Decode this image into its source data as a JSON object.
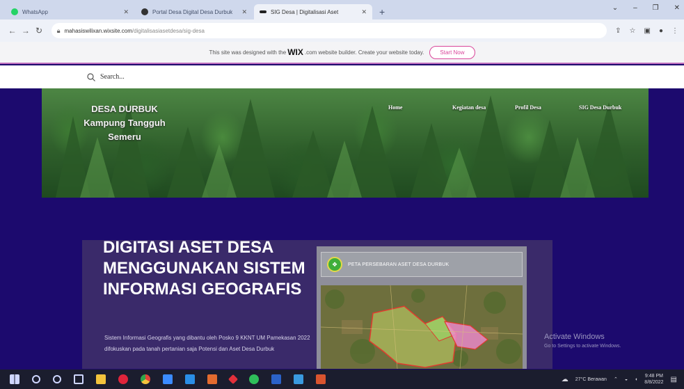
{
  "browser": {
    "tabs": [
      {
        "label": "WhatsApp",
        "color": "#25d366",
        "active": false
      },
      {
        "label": "Portal Desa Digital Desa Durbuk",
        "color": "#333333",
        "active": false
      },
      {
        "label": "SIG Desa | Digitalisasi Aset",
        "color": "#222222",
        "active": true
      }
    ],
    "new_tab": "+",
    "url_host": "mahasiswilixan.wixsite.com",
    "url_path": "/digitalisasiasetdesa/sig-desa"
  },
  "wix_banner": {
    "text_before": "This site was designed with the",
    "logo": "WIX",
    "text_after": ".com website builder. Create your website today.",
    "start_button": "Start Now"
  },
  "search": {
    "label": "Search..."
  },
  "site": {
    "brand_line1": "DESA DURBUK",
    "brand_line2": "Kampung Tangguh",
    "brand_line3": "Semeru",
    "nav": [
      "Home",
      "Kegiatan desa",
      "Profil Desa",
      "SIG Desa Durbuk"
    ]
  },
  "content": {
    "heading": "DIGITASI  ASET DESA MENGGUNAKAN SISTEM INFORMASI GEOGRAFIS",
    "body": "Sistem Informasi Geografis yang dibantu oleh Posko 9 KKNT UM Pamekasan 2022 difokuskan pada tanah pertanian saja Potensi dan Aset Desa Durbuk",
    "map_title": "PETA PERSEBARAN ASET DESA DURBUK"
  },
  "watermark": {
    "line1": "Activate Windows",
    "line2": "Go to Settings to activate Windows."
  },
  "taskbar": {
    "weather": "27°C  Berawan",
    "time": "9:48 PM",
    "date": "8/8/2022"
  }
}
